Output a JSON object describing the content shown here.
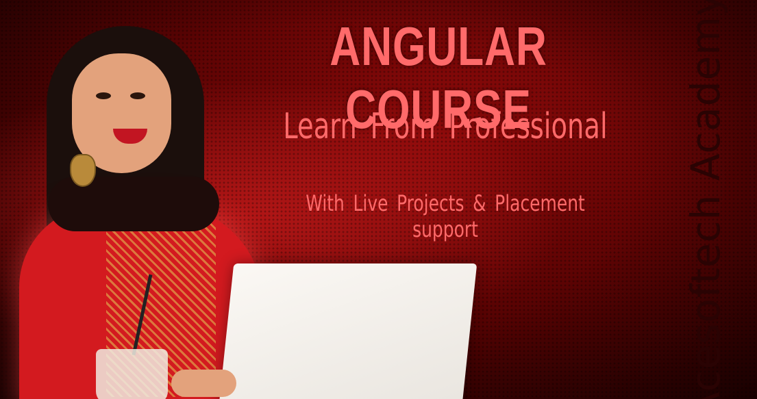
{
  "banner": {
    "headline": "ANGULAR COURSE",
    "subhead": "Learn From Professional",
    "tagline": "With Live Projects & Placement support",
    "academy": "Acesoftech Academy"
  },
  "colors": {
    "text_accent": "#ff6a6a",
    "academy_text": "#2a0303",
    "background": "#6a0505"
  }
}
